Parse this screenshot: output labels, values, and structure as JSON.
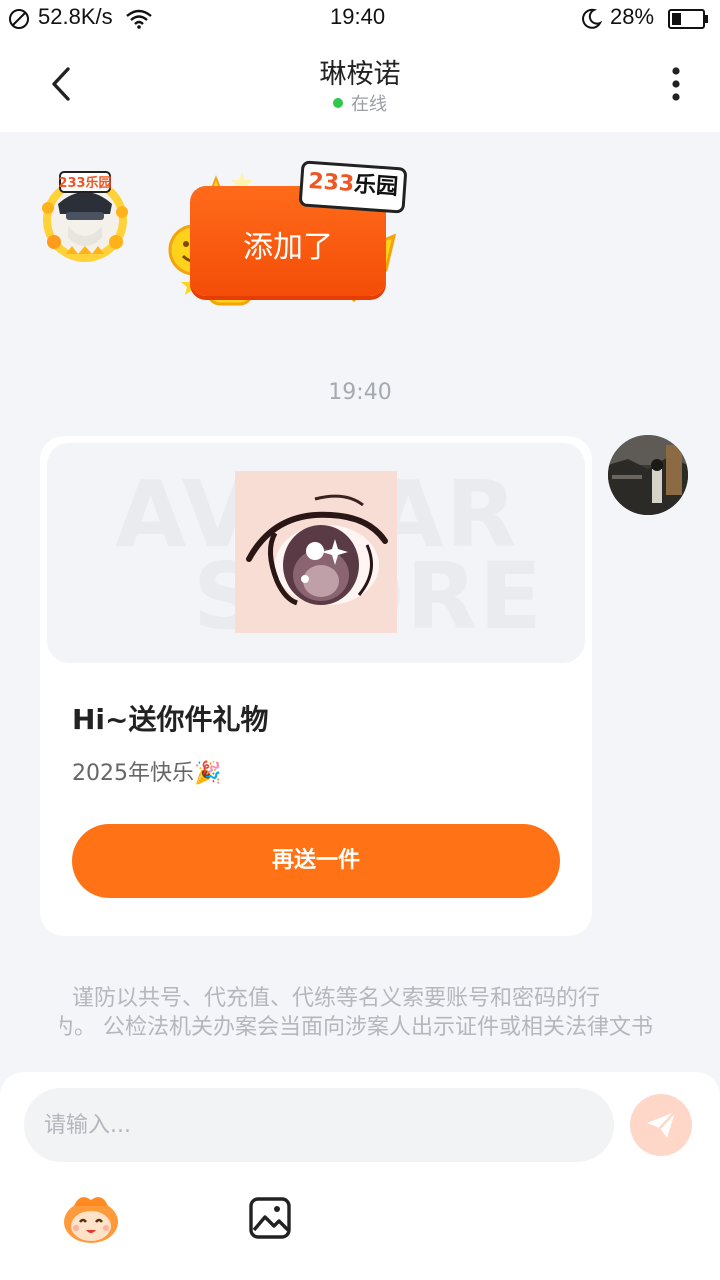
{
  "status_bar": {
    "speed": "52.8K/s",
    "time": "19:40",
    "battery": "28%"
  },
  "header": {
    "title": "琳桉诺",
    "status": "在线"
  },
  "sticker": {
    "badge_number": "233",
    "badge_text": "乐园",
    "text": "添加了"
  },
  "timestamp": "19:40",
  "gift_card": {
    "watermark_line1": "AVATAR",
    "watermark_line2": "STORE",
    "title": "Hi~送你件礼物",
    "subtitle": "2025年快乐🎉",
    "button_label": "再送一件"
  },
  "notice": {
    "line1": "谨防以共号、代充值、代练等名义索要账号和密码的行",
    "line2": "为。 公检法机关办案会当面向涉案人出示证件或相关法律文书"
  },
  "input": {
    "placeholder": "请输入..."
  },
  "colors": {
    "accent": "#ff7316",
    "online": "#2ec94c",
    "background": "#f3f5f8"
  },
  "icons": {
    "back": "chevron-left-icon",
    "more": "more-vertical-icon",
    "send": "send-icon",
    "emoji": "emoji-mascot-icon",
    "image": "image-icon"
  }
}
